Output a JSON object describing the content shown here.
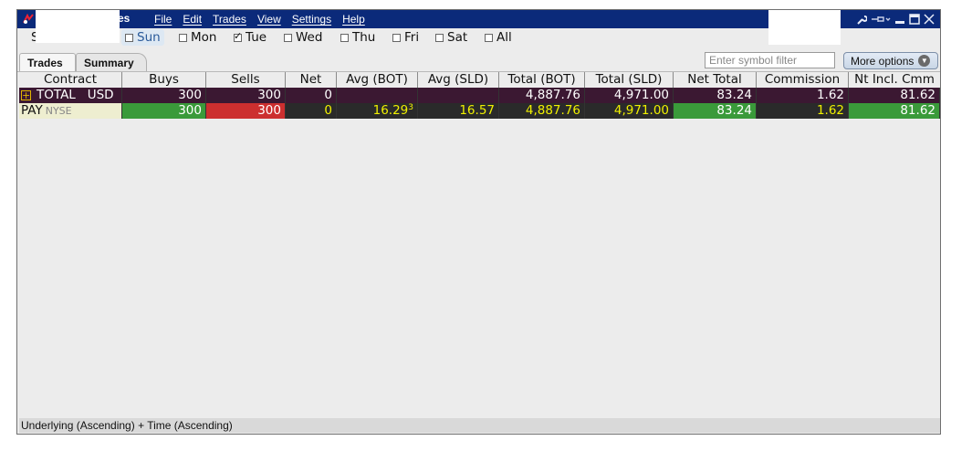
{
  "titlebar": {
    "title": "ades",
    "menu": [
      "File",
      "Edit",
      "Trades",
      "View",
      "Settings",
      "Help"
    ]
  },
  "days": {
    "leading_letter": "S",
    "items": [
      {
        "label": "Sun",
        "checked": false,
        "highlighted": true
      },
      {
        "label": "Mon",
        "checked": false
      },
      {
        "label": "Tue",
        "checked": true
      },
      {
        "label": "Wed",
        "checked": false
      },
      {
        "label": "Thu",
        "checked": false
      },
      {
        "label": "Fri",
        "checked": false
      },
      {
        "label": "Sat",
        "checked": false
      },
      {
        "label": "All",
        "checked": false
      }
    ]
  },
  "tabs": [
    "Trades",
    "Summary"
  ],
  "toolbar": {
    "filter_placeholder": "Enter symbol filter",
    "more_options": "More options"
  },
  "table": {
    "columns": [
      "Contract",
      "Buys",
      "Sells",
      "Net",
      "Avg (BOT)",
      "Avg (SLD)",
      "Total (BOT)",
      "Total (SLD)",
      "Net Total",
      "Commission",
      "Nt Incl. Cmm"
    ],
    "total_row": {
      "label": "TOTAL",
      "currency": "USD",
      "buys": "300",
      "sells": "300",
      "net": "0",
      "avg_bot": "",
      "avg_sld": "",
      "total_bot": "4,887.76",
      "total_sld": "4,971.00",
      "net_total": "83.24",
      "commission": "1.62",
      "nt_incl": "81.62"
    },
    "pay_row": {
      "symbol": "PAY",
      "exchange": "NYSE",
      "buys": "300",
      "sells": "300",
      "net": "0",
      "avg_bot": "16.29",
      "avg_bot_sup": "3",
      "avg_sld": "16.57",
      "total_bot": "4,887.76",
      "total_sld": "4,971.00",
      "net_total": "83.24",
      "commission": "1.62",
      "nt_incl": "81.62"
    }
  },
  "status": "Underlying (Ascending)  +  Time (Ascending)",
  "colors": {
    "titlebar": "#0b2a7a",
    "total_row": "#3b1832",
    "buys_green": "#3a9a3a",
    "sells_red": "#cc2f2f",
    "value_yellow": "#f0f000"
  }
}
